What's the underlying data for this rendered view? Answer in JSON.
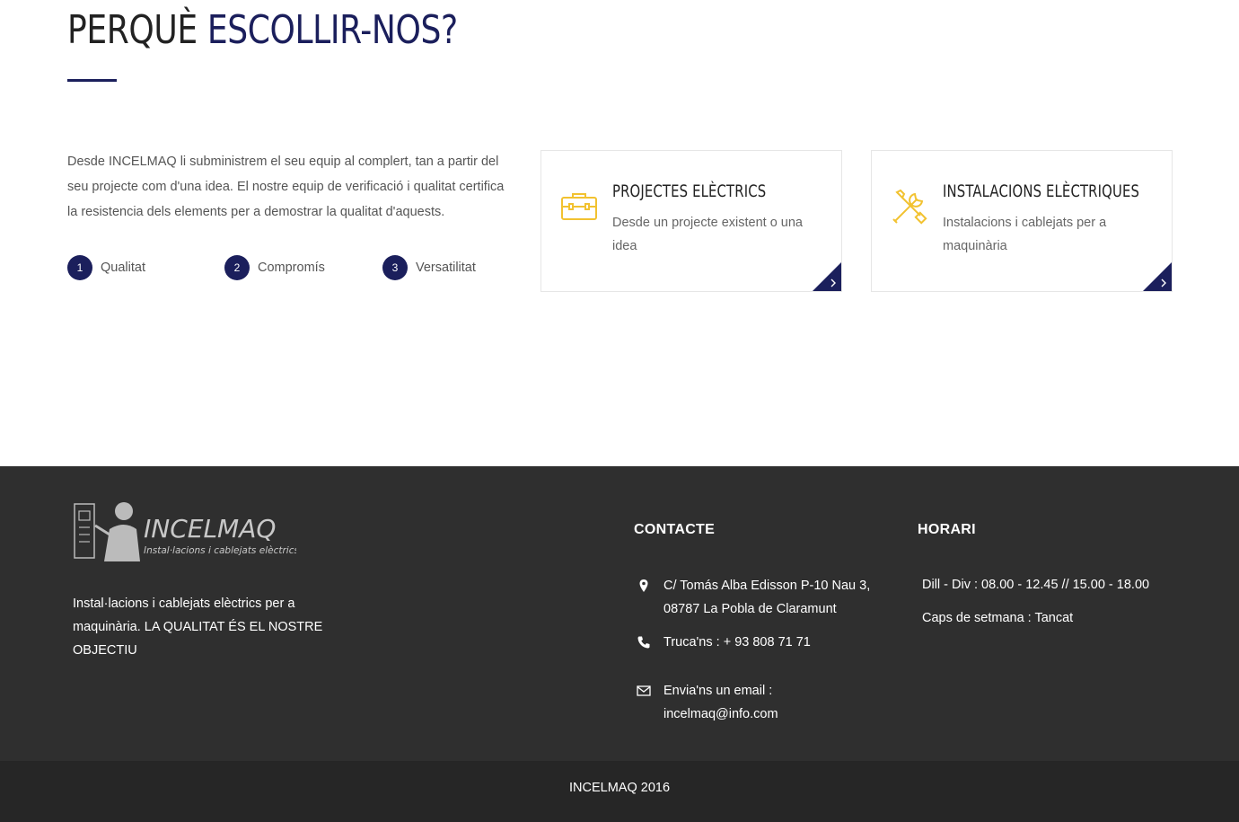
{
  "why": {
    "title_plain": "PERQUÈ",
    "title_accent": "ESCOLLIR-NOS?",
    "description": "Desde INCELMAQ li subministrem el seu equip al complert, tan a partir del seu projecte com d'una idea. El nostre equip de verificació i qualitat certifica la resistencia dels elements per a demostrar la qualitat d'aquests.",
    "steps": [
      {
        "num": "1",
        "label": "Qualitat"
      },
      {
        "num": "2",
        "label": "Compromís"
      },
      {
        "num": "3",
        "label": "Versatilitat"
      }
    ],
    "cards": [
      {
        "title": "PROJECTES ELÈCTRICS",
        "text": "Desde un projecte existent o una idea",
        "icon": "toolbox-icon"
      },
      {
        "title": "INSTALACIONS ELÈCTRIQUES",
        "text": "Instalacions i cablejats per a maquinària",
        "icon": "tools-icon"
      }
    ]
  },
  "footer": {
    "logo_name": "INCELMAQ",
    "logo_tagline": "Instal·lacions i cablejats elèctrics",
    "about": "Instal·lacions i cablejats elèctrics per a maquinària. LA QUALITAT ÉS EL NOSTRE OBJECTIU",
    "contact_heading": "CONTACTE",
    "contact": [
      {
        "icon": "location-pin-icon",
        "text": "C/ Tomás Alba Edisson P-10 Nau 3, 08787 La Pobla de Claramunt"
      },
      {
        "icon": "phone-icon",
        "text": "Truca'ns : + 93 808 71 71"
      },
      {
        "icon": "envelope-icon",
        "text": "Envia'ns un email : incelmaq@info.com"
      }
    ],
    "hours_heading": "HORARI",
    "hours": [
      "Dill - Div : 08.00 - 12.45 // 15.00 - 18.00",
      "Caps de setmana : Tancat"
    ],
    "copyright": "INCELMAQ 2016"
  },
  "colors": {
    "accent_navy": "#1b1f5c",
    "icon_yellow": "#f2c230",
    "footer_bg": "#2f2f2f",
    "bottom_bar_bg": "#262626"
  }
}
